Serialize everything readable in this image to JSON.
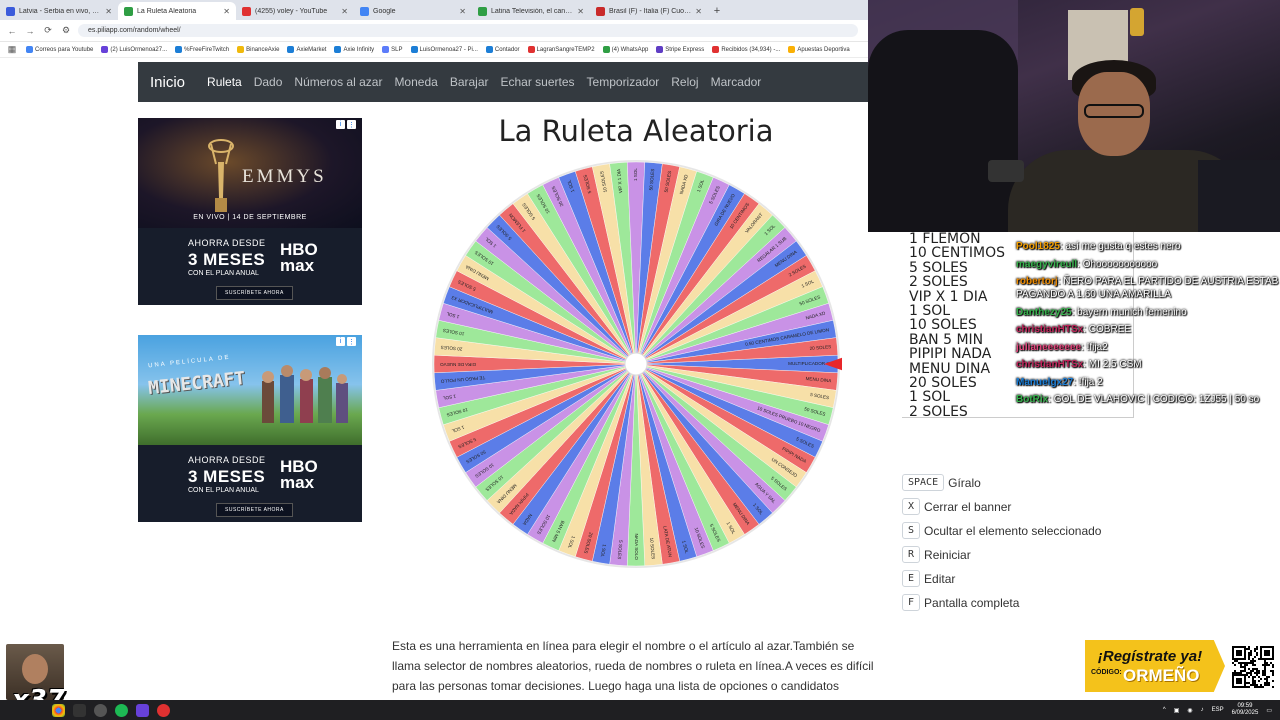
{
  "browser": {
    "tabs": [
      {
        "title": "Latvia - Serbia en vivo, resultado",
        "color": "#3b5bdb",
        "active": false
      },
      {
        "title": "La Ruleta Aleatoria",
        "color": "#2f9e44",
        "active": true
      },
      {
        "title": "(4255) voley - YouTube",
        "color": "#e03131",
        "active": false
      },
      {
        "title": "Google",
        "color": "#4285f4",
        "active": false
      },
      {
        "title": "Latina Televisión, el canal 2 de",
        "color": "#2f9e44",
        "active": false
      },
      {
        "title": "Brasil (F) - Italia (F) Cuotas",
        "color": "#c92a2a",
        "active": false
      }
    ],
    "new_tab": "+",
    "url": "es.piliapp.com/random/wheel/",
    "bookmarks": [
      {
        "label": "Correos para Youtube",
        "color": "#4285f4"
      },
      {
        "label": "(2) LuisOrmenoa27...",
        "color": "#6741d9"
      },
      {
        "label": "%FreeFireTwitch",
        "color": "#1c7ed6"
      },
      {
        "label": "BinanceAxie",
        "color": "#f0b90b"
      },
      {
        "label": "AxieMarket",
        "color": "#1c7ed6"
      },
      {
        "label": "Axie Infinity",
        "color": "#1c7ed6"
      },
      {
        "label": "SLP",
        "color": "#5c7cfa"
      },
      {
        "label": "LuisOrmenoa27 - Pi...",
        "color": "#1c7ed6"
      },
      {
        "label": "Contador",
        "color": "#1c7ed6"
      },
      {
        "label": "LagranSangreTEMP2",
        "color": "#e03131"
      },
      {
        "label": "(4) WhatsApp",
        "color": "#2f9e44"
      },
      {
        "label": "Stripe Express",
        "color": "#5f3dc4"
      },
      {
        "label": "Recibidos (34,934) -...",
        "color": "#e03131"
      },
      {
        "label": "Apuestas Deportiva",
        "color": "#fab005"
      }
    ]
  },
  "site": {
    "brand": "Inicio",
    "nav": [
      "Ruleta",
      "Dado",
      "Números al azar",
      "Moneda",
      "Barajar",
      "Echar suertes",
      "Temporizador",
      "Reloj",
      "Marcador"
    ],
    "title": "La Ruleta Aleatoria",
    "description": "Esta es una herramienta en línea para elegir el nombre o el artículo al azar.También se llama selector de nombres aleatorios, rueda de nombres o ruleta en línea.A veces es difícil para las personas tomar decisiones. Luego haga una lista de opciones o candidatos existentes y luego seleccione al azar uno de ellos. En este caso, puede utilizar nuestra herramienta para"
  },
  "ads": {
    "ad1": {
      "brand": "EMMYS",
      "tagline": "EN VIVO | 14 DE SEPTIEMBRE",
      "offer1": "AHORRA DESDE",
      "offer2": "3 MESES",
      "offer3": "CON EL PLAN ANUAL",
      "logo1": "HBO",
      "logo2": "max",
      "cta": "SUSCRÍBETE AHORA"
    },
    "ad2": {
      "kicker": "UNA PELÍCULA DE",
      "brand": "MINECRAFT",
      "offer1": "AHORRA DESDE",
      "offer2": "3 MESES",
      "offer3": "CON EL PLAN ANUAL",
      "logo1": "HBO",
      "logo2": "max",
      "cta": "SUSCRÍBETE AHORA"
    }
  },
  "wheel": {
    "pointer_color": "#e8262a",
    "palette": [
      "#5b7de8",
      "#ee6a6a",
      "#f7e0a8",
      "#9ee89a",
      "#c992e6"
    ],
    "segments": [
      "MULTIPLICADOR X3",
      "MENU DINA",
      "5 SOLES",
      "50 SOLES",
      "10 SOLES PRUEBO 10 NEGRO",
      "5 SOLES",
      "PIPIPI NADA",
      "UN CONSEJO",
      "5 SOLES",
      "AGUA Y SAL",
      "1 SOL",
      "MENU DINA",
      "1 SOL",
      "5 SOLES",
      "10 SOLES",
      "1 SOL",
      "LATA DE ATUN",
      "10 SOLES",
      "NADA SOLO",
      "5 SOLES",
      "1 SOL",
      "20 SOLES",
      "1 SOL",
      "BAN 5 MIN",
      "10 SOLES",
      "NADA",
      "PIPIPI NADA",
      "MENU DINA",
      "10 SOLES",
      "10 SOLES",
      "50 SOLES",
      "5 SOLES",
      "1 SOL",
      "10 SOLES",
      "1 SOL",
      "TE PAGO UN POLLO",
      "GIRA DE NUEVO",
      "20 SOLES",
      "10 SOLES",
      "1 SOL",
      "MULTIPLICADOR X3",
      "5 SOLES",
      "MENU DINA",
      "10 SOLES",
      "1 SOL",
      "5 SOLES",
      "1 FLEMON",
      "5 SOLES",
      "10 SOLES",
      "20 SOLES",
      "1 SOL",
      "5 SOLES",
      "10 SOLES",
      "VIP X 1 DIA",
      "1 SOL",
      "50 SOLES",
      "50 SOLES",
      "NADA XD",
      "1 SOL",
      "5 SOLES",
      "GIRA DE NUEVO",
      "10 CENTIMOS",
      "VALORANT",
      "1 SOL",
      "REGALAR 1 SUB",
      "MENU DINA",
      "2 SOLES",
      "1 SOL",
      "50 SOLES",
      "NADA XD",
      "0.50 CENTIMOS CARAMELO DE LIMON",
      "20 SOLES"
    ]
  },
  "shortcuts": [
    {
      "key": "SPACE",
      "label": "Gíralo"
    },
    {
      "key": "X",
      "label": "Cerrar el banner"
    },
    {
      "key": "S",
      "label": "Ocultar el elemento seleccionado"
    },
    {
      "key": "R",
      "label": "Reiniciar"
    },
    {
      "key": "E",
      "label": "Editar"
    },
    {
      "key": "F",
      "label": "Pantalla completa"
    }
  ],
  "option_list": [
    "1 FLEMON",
    "10 CENTIMOS",
    "5 SOLES",
    "2 SOLES",
    "VIP X 1 DIA",
    "1 SOL",
    "10 SOLES",
    "BAN 5 MIN",
    "PIPIPI NADA",
    "MENU DINA",
    "20 SOLES",
    "1 SOL",
    "2 SOLES"
  ],
  "chat": [
    {
      "user": "Pool1825",
      "color": "#f59f00",
      "text": ": así me gusta q estes nero"
    },
    {
      "user": "maegyvireull",
      "color": "#37b24d",
      "text": ": Ohooooooooooo"
    },
    {
      "user": "robertorj",
      "color": "#f08c00",
      "text": ": ÑERO PARA EL PARTIDO DE AUSTRIA ESTAB PAGANDO A 1.60 UNA AMARILLA"
    },
    {
      "user": "Danthezy25",
      "color": "#37b24d",
      "text": ": bayern munich femenino"
    },
    {
      "user": "christianHTSx",
      "color": "#c2255c",
      "text": ": COBREE"
    },
    {
      "user": "julianeeeeeee",
      "color": "#e64980",
      "text": ": !fija2"
    },
    {
      "user": "christianHTSx",
      "color": "#c2255c",
      "text": ": MI 2.5 CSM"
    },
    {
      "user": "Manuelgx27",
      "color": "#1c7ed6",
      "text": ": !fija 2"
    },
    {
      "user": "BotRix",
      "color": "#37b24d",
      "text": ": GOL DE VLAHOVIC | CODIGO: 1ZJ55 | 50 so"
    }
  ],
  "overlay": {
    "emote_count": "x37",
    "promo_line1": "¡Regístrate ya!",
    "promo_code_label": "CÓDIGO:",
    "promo_code": "ORMEÑO"
  },
  "taskbar": {
    "lang": "ESP",
    "time": "09:59",
    "date": "6/09/2025"
  }
}
